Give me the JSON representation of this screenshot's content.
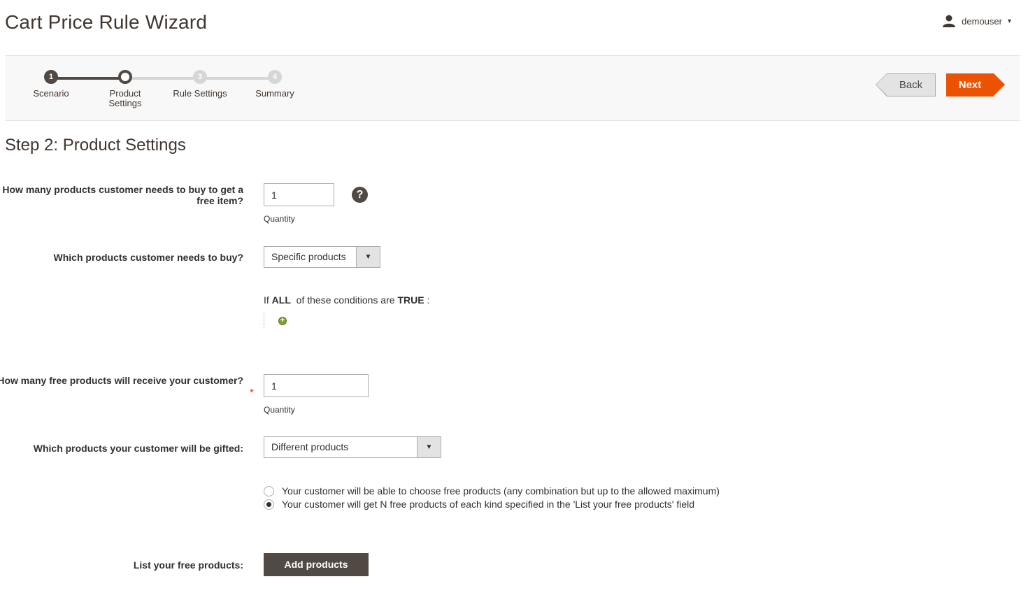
{
  "header": {
    "title": "Cart Price Rule Wizard",
    "user": {
      "name": "demouser",
      "icon": "user-icon",
      "caret": "▾"
    }
  },
  "wizard": {
    "steps": [
      {
        "number": "1",
        "label": "Scenario",
        "state": "done"
      },
      {
        "number": "2",
        "label": "Product Settings",
        "state": "current"
      },
      {
        "number": "3",
        "label": "Rule Settings",
        "state": "future"
      },
      {
        "number": "4",
        "label": "Summary",
        "state": "future"
      }
    ],
    "back_label": "Back",
    "next_label": "Next",
    "accent_color": "#eb5202"
  },
  "section": {
    "title": "Step 2: Product Settings"
  },
  "form": {
    "buy_qty": {
      "label": "How many products customer needs to buy to get a free item?",
      "value": "1",
      "note": "Quantity",
      "help": "?"
    },
    "buy_products": {
      "label": "Which products customer needs to buy?",
      "selected": "Specific products",
      "conditions": {
        "prefix": "If",
        "aggregator": "ALL",
        "middle": "of these conditions are",
        "value": "TRUE",
        "suffix": ":"
      }
    },
    "free_qty": {
      "label": "How many free products will receive your customer?",
      "required": "*",
      "value": "1",
      "note": "Quantity"
    },
    "gift_products": {
      "label": "Which products your customer will be gifted:",
      "selected": "Different products",
      "options": [
        {
          "label": "Your customer will be able to choose free products (any combination but up to the allowed maximum)",
          "checked": false
        },
        {
          "label": "Your customer will get N free products of each kind specified in the 'List your free products' field",
          "checked": true
        }
      ]
    },
    "free_list": {
      "label": "List your free products:",
      "button_label": "Add products"
    }
  }
}
